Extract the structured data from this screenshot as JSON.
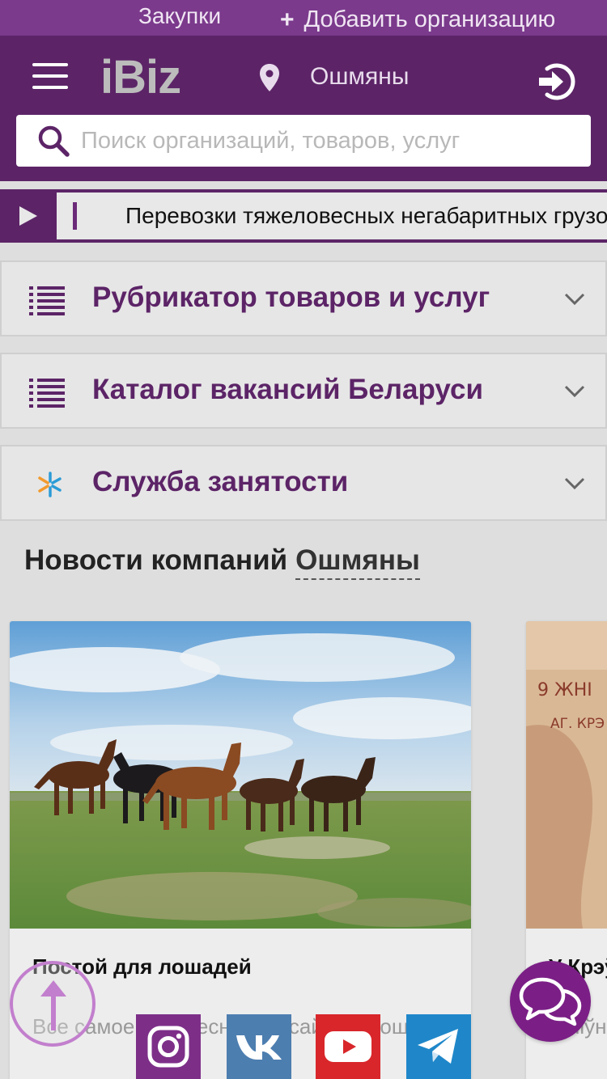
{
  "topbar": {
    "purchases": "Закупки",
    "add_org": "Добавить организацию"
  },
  "header": {
    "logo": "iBiz",
    "city": "Ошмяны",
    "search_placeholder": "Поиск организаций, товаров, услуг"
  },
  "ticker": {
    "text": "Перевозки тяжеловесных негабаритных грузов"
  },
  "accordion": [
    {
      "title": "Рубрикатор товаров и услуг",
      "icon": "list-icon"
    },
    {
      "title": "Каталог вакансий Беларуси",
      "icon": "list-icon"
    },
    {
      "title": "Служба занятости",
      "icon": "employment-service-icon"
    }
  ],
  "news": {
    "title": "Новости компаний",
    "city": "Ошмяны",
    "cards": [
      {
        "title": "Постой для лошадей",
        "desc": "Все самое интересное на сайте о лошадях",
        "photo": "horses-photo"
      },
      {
        "title": "У Крэўскім",
        "desc": "Жніўня",
        "photo": "sign-photo"
      }
    ]
  },
  "social": [
    "instagram",
    "vk",
    "youtube",
    "telegram"
  ],
  "colors": {
    "brand_dark": "#5c2467",
    "brand_light": "#7b3a8c",
    "chat": "#7b1f86"
  }
}
